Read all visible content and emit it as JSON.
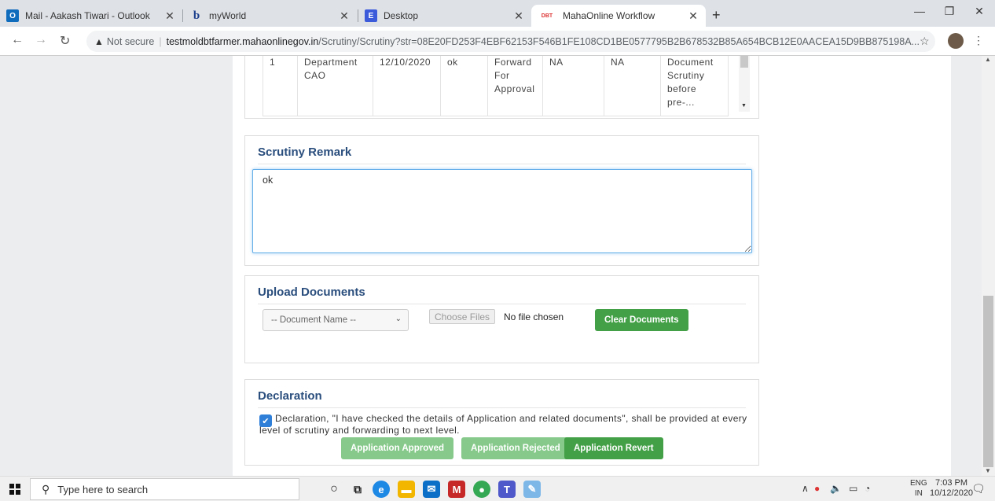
{
  "browser": {
    "tabs": [
      {
        "title": "Mail - Aakash Tiwari - Outlook",
        "favicon": "outlook-icon",
        "favicon_text": "O",
        "color": "#0f6cbd"
      },
      {
        "title": "myWorld",
        "favicon": "b-icon",
        "favicon_text": "b",
        "color": "#ffffff"
      },
      {
        "title": "Desktop",
        "favicon": "e-icon",
        "favicon_text": "E",
        "color": "#3b5bdb"
      },
      {
        "title": "MahaOnline Workflow",
        "favicon": "dbt-icon",
        "favicon_text": "DBT",
        "color": "#ffffff"
      }
    ],
    "address": {
      "security": "Not secure",
      "host": "testmoldbtfarmer.mahaonlinegov.in",
      "path": "/Scrutiny/Scrutiny?str=08E20FD253F4EBF62153F546B1FE108CD1BE0577795B2B678532B85A654BCB12E0AACEA15D9BB875198A..."
    }
  },
  "history_row": {
    "cells": [
      "1",
      "Department CAO",
      "12/10/2020",
      "ok",
      "Forward For Approval",
      "NA",
      "NA",
      "Document Scrutiny before pre-..."
    ]
  },
  "scrutiny": {
    "title": "Scrutiny Remark",
    "remark_value": "ok"
  },
  "upload": {
    "title": "Upload Documents",
    "document_select": "-- Document Name --",
    "choose_files": "Choose Files",
    "no_file": "No file chosen",
    "clear_button": "Clear Documents"
  },
  "declaration": {
    "title": "Declaration",
    "checked": true,
    "text": "Declaration, \"I have checked the details of Application and related documents\", shall be provided at every level of scrutiny and forwarding to next level.",
    "approved_button": "Application Approved",
    "rejected_button": "Application Rejected",
    "revert_button": "Application Revert"
  },
  "taskbar": {
    "search_placeholder": "Type here to search",
    "lang_top": "ENG",
    "lang_bottom": "IN",
    "time": "7:03 PM",
    "date": "10/12/2020"
  },
  "colors": {
    "accent_green": "#43a047",
    "disabled_green": "#86c98a",
    "heading_blue": "#2a4e7d"
  }
}
